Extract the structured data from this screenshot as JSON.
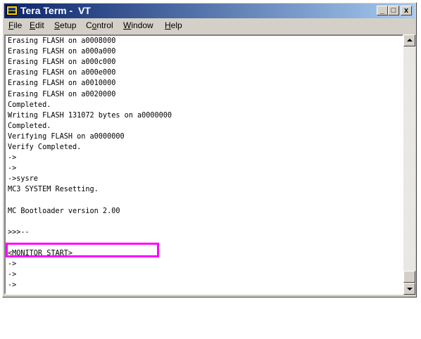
{
  "window": {
    "title": "Tera Term -  VT",
    "controls": {
      "minimize": "_",
      "maximize": "□",
      "close": "x"
    }
  },
  "menu": [
    {
      "accel": "F",
      "rest": "ile"
    },
    {
      "accel": "E",
      "rest": "dit"
    },
    {
      "accel": "S",
      "rest": "etup"
    },
    {
      "pre": "C",
      "accel": "o",
      "rest": "ntrol"
    },
    {
      "accel": "W",
      "rest": "indow"
    },
    {
      "accel": "H",
      "rest": "elp"
    }
  ],
  "terminal": {
    "lines": [
      "Erasing FLASH on a0008000",
      "Erasing FLASH on a000a000",
      "Erasing FLASH on a000c000",
      "Erasing FLASH on a000e000",
      "Erasing FLASH on a0010000",
      "Erasing FLASH on a0020000",
      "Completed.",
      "Writing FLASH 131072 bytes on a0000000",
      "Completed.",
      "Verifying FLASH on a0000000",
      "Verify Completed.",
      "->",
      "->",
      "->sysre",
      "MC3 SYSTEM Resetting.",
      "",
      "MC Bootloader version 2.00",
      "",
      ">>>--",
      "",
      "<MONITOR START>",
      "->",
      "->",
      "->"
    ]
  },
  "highlight_color": "#ff00ff",
  "titlebar_gradient": [
    "#0a246a",
    "#a6caf0"
  ]
}
